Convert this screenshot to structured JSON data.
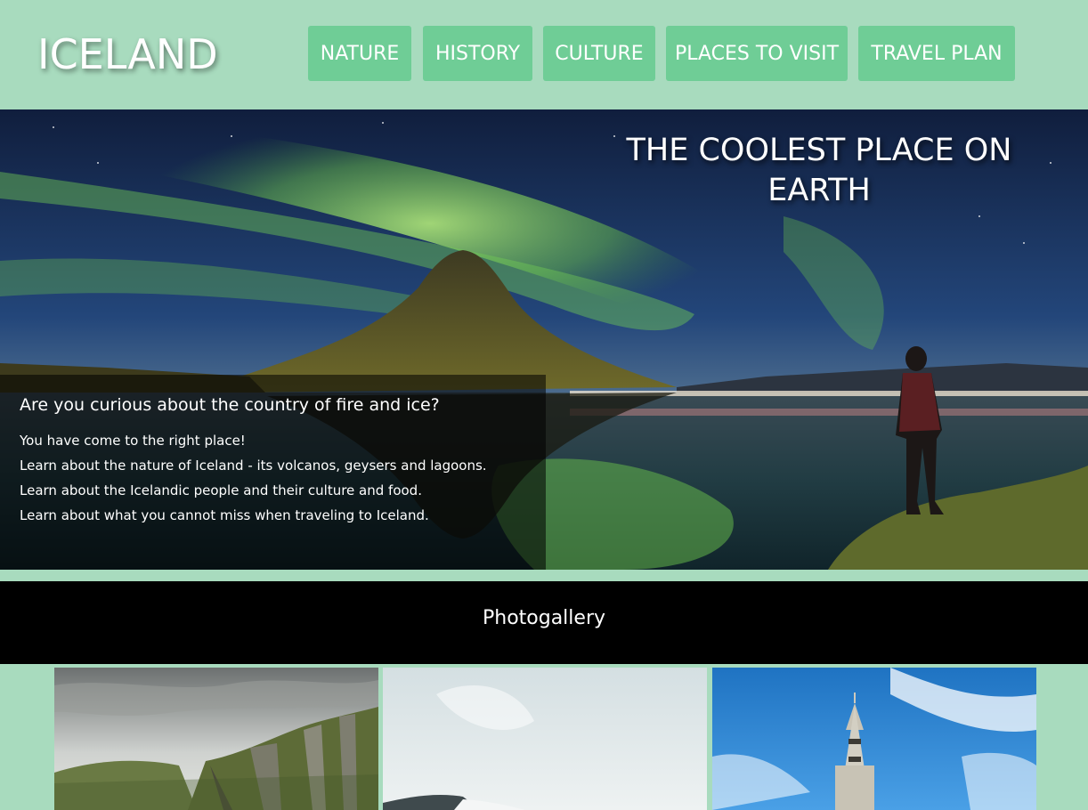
{
  "header": {
    "logo": "ICELAND",
    "nav": [
      {
        "label": "NATURE"
      },
      {
        "label": "HISTORY"
      },
      {
        "label": "CULTURE"
      },
      {
        "label": "PLACES TO VISIT"
      },
      {
        "label": "TRAVEL PLAN"
      }
    ]
  },
  "hero": {
    "title": "THE COOLEST PLACE ON EARTH",
    "image": "aurora-over-kirkjufell-photo",
    "intro": {
      "heading": "Are you curious about the country of fire and ice?",
      "lines": [
        "You have come to the right place!",
        "Learn about the nature of Iceland - its volcanos, geysers and lagoons.",
        "Learn about the Icelandic people and their culture and food.",
        "Learn about what you cannot miss when traveling to Iceland."
      ]
    }
  },
  "gallery": {
    "title": "Photogallery",
    "images": [
      "mossy-canyon-photo",
      "misty-coast-photo",
      "church-tower-photo"
    ]
  },
  "colors": {
    "page_background": "#a8dbbe",
    "nav_button": "#6fcd96",
    "gallery_bar": "#000000",
    "text": "#ffffff"
  }
}
